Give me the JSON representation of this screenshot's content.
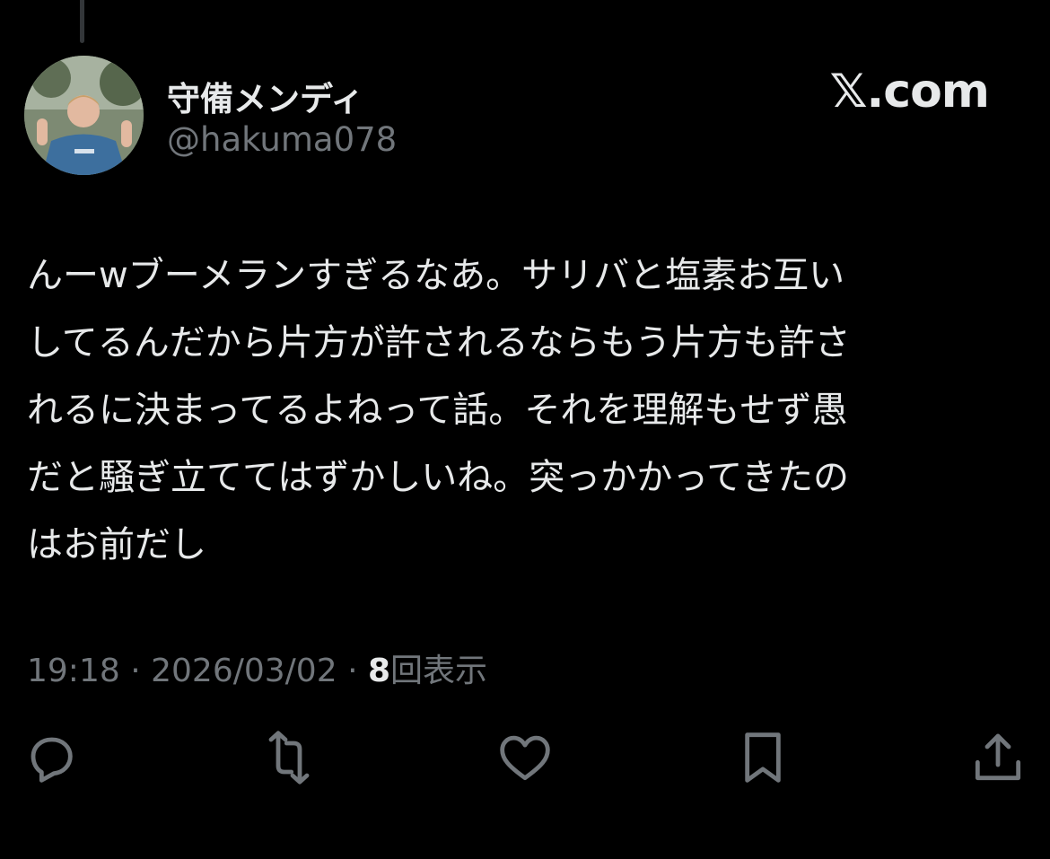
{
  "author": {
    "display_name": "守備メンディ",
    "handle": "@hakuma078"
  },
  "brand": "𝕏.com",
  "tweet": {
    "lines": [
      "んーwブーメランすぎるなあ。サリバと塩素お互い",
      "してるんだから片方が許されるならもう片方も許さ",
      "れるに決まってるよねって話。それを理解もせず愚",
      "だと騒ぎ立ててはずかしいね。突っかかってきたの",
      "はお前だし"
    ]
  },
  "meta": {
    "time": "19:18",
    "separator": "·",
    "date": "2026/03/02",
    "views_count": "8",
    "views_label": "回表示"
  },
  "colors": {
    "background": "#000000",
    "text_primary": "#e7e9ea",
    "text_secondary": "#71767b",
    "icon": "#71767b"
  },
  "actions": [
    {
      "icon": "reply-icon"
    },
    {
      "icon": "retweet-icon"
    },
    {
      "icon": "like-icon"
    },
    {
      "icon": "bookmark-icon"
    },
    {
      "icon": "share-icon"
    }
  ]
}
